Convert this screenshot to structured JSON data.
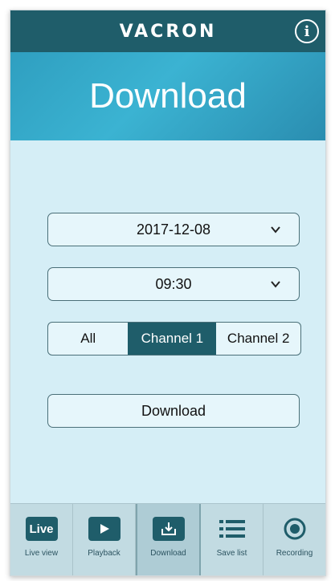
{
  "header": {
    "brand": "VACRON",
    "info_glyph": "i"
  },
  "hero": {
    "title": "Download"
  },
  "form": {
    "date_value": "2017-12-08",
    "time_value": "09:30",
    "channels": [
      "All",
      "Channel 1",
      "Channel 2"
    ],
    "selected_channel": "Channel 1",
    "download_label": "Download"
  },
  "tabbar": {
    "tabs": [
      {
        "label": "Live view",
        "icon": "live-icon",
        "icon_text": "Live"
      },
      {
        "label": "Playback",
        "icon": "play-icon"
      },
      {
        "label": "Download",
        "icon": "download-icon"
      },
      {
        "label": "Save list",
        "icon": "list-icon"
      },
      {
        "label": "Recording",
        "icon": "record-icon"
      }
    ],
    "active_tab": "Download"
  },
  "colors": {
    "primary": "#1f5d6a",
    "hero": "#3bb3d2",
    "background": "#d5eef6",
    "tabbar": "#c2dbe2"
  }
}
